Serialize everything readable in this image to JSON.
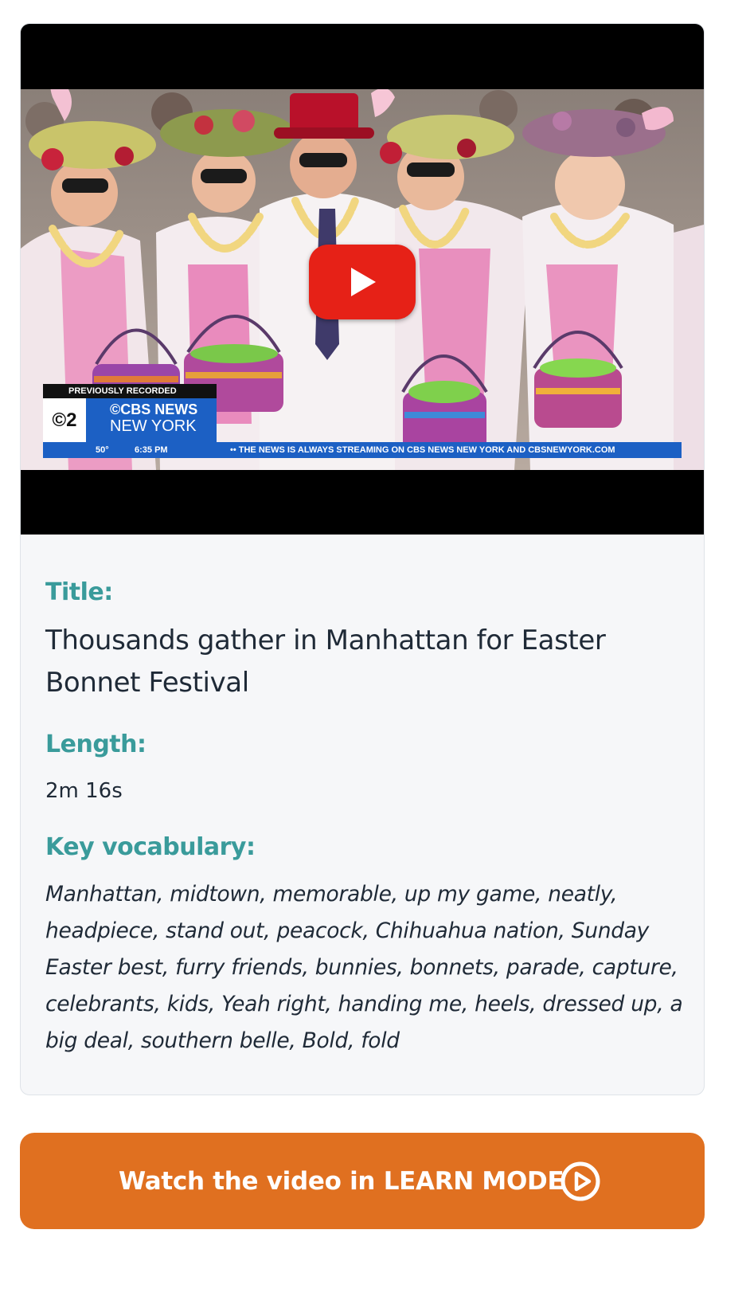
{
  "video": {
    "overlay": {
      "label": "PREVIOUSLY RECORDED",
      "logo": "©2",
      "brand_line1": "©CBS NEWS",
      "brand_line2": "NEW YORK",
      "temperature": "50°",
      "time": "6:35 PM",
      "ticker": "•• THE NEWS IS ALWAYS STREAMING ON CBS NEWS NEW YORK AND CBSNEWYORK.COM"
    },
    "play_icon": "play-icon"
  },
  "details": {
    "title_label": "Title:",
    "title_value": "Thousands gather in Manhattan for Easter Bonnet Festival",
    "length_label": "Length:",
    "length_value": "2m 16s",
    "vocab_label": "Key vocabulary:",
    "vocab_value": "Manhattan, midtown, memorable, up my game, neatly, headpiece, stand out, peacock, Chihuahua nation, Sunday Easter best, furry friends, bunnies, bonnets, parade, capture, celebrants, kids, Yeah right, handing me, heels, dressed up, a big deal, southern belle, Bold, fold"
  },
  "cta": {
    "label": "Watch the video in LEARN MODE",
    "icon": "play-circle-icon"
  },
  "colors": {
    "accent_teal": "#3a9b9b",
    "cta_orange": "#e07020",
    "youtube_red": "#e62117",
    "news_blue": "#1c60c4"
  }
}
